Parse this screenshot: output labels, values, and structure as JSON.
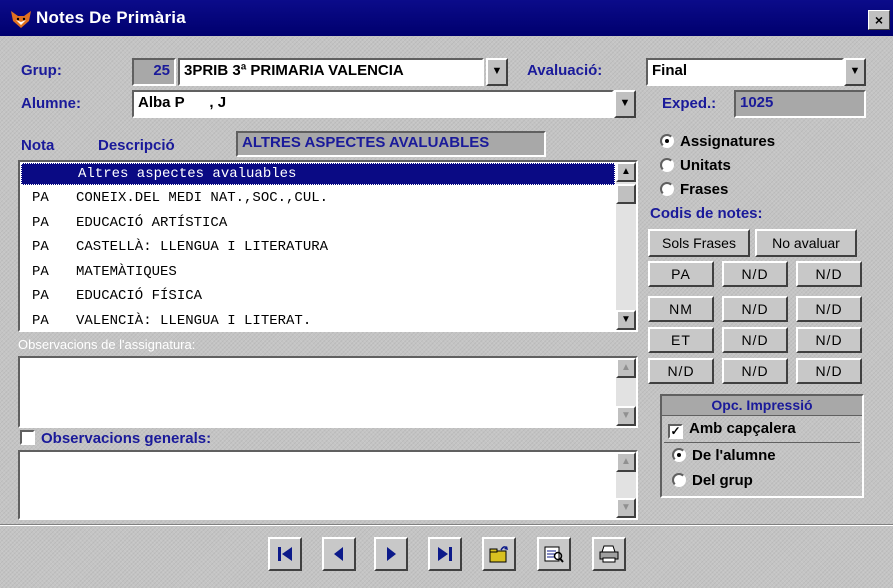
{
  "window": {
    "title": "Notes De Primària",
    "close_glyph": "×"
  },
  "grup": {
    "label": "Grup:",
    "number": "25",
    "value": "3PRIB 3ª PRIMARIA VALENCIA"
  },
  "avaluacio": {
    "label": "Avaluació:",
    "value": "Final"
  },
  "alumne": {
    "label": "Alumne:",
    "value": "Alba P      , J"
  },
  "exped": {
    "label": "Exped.:",
    "value": "1025"
  },
  "nota_header": {
    "nota_label": "Nota",
    "descripcio_label": "Descripció",
    "descripcio_value": "ALTRES ASPECTES AVALUABLES"
  },
  "subjects": [
    {
      "code": "",
      "name": "Altres aspectes avaluables"
    },
    {
      "code": "PA",
      "name": "CONEIX.DEL MEDI NAT.,SOC.,CUL."
    },
    {
      "code": "PA",
      "name": "EDUCACIÓ ARTÍSTICA"
    },
    {
      "code": "PA",
      "name": "CASTELLÀ: LLENGUA I LITERATURA"
    },
    {
      "code": "PA",
      "name": "MATEMÀTIQUES"
    },
    {
      "code": "PA",
      "name": "EDUCACIÓ FÍSICA"
    },
    {
      "code": "PA",
      "name": "VALENCIÀ: LLENGUA I LITERAT."
    }
  ],
  "view_options": {
    "assignatures": "Assignatures",
    "unitats": "Unitats",
    "frases": "Frases",
    "selected": "Assignatures"
  },
  "codis": {
    "label": "Codis de notes:",
    "sols_frases": "Sols Frases",
    "no_avaluar": "No avaluar",
    "grid": [
      [
        "PA",
        "N/D",
        "N/D"
      ],
      [
        "NM",
        "N/D",
        "N/D"
      ],
      [
        "ET",
        "N/D",
        "N/D"
      ],
      [
        "N/D",
        "N/D",
        "N/D"
      ]
    ]
  },
  "observacions_assignatura": {
    "label": "Observacions de l'assignatura:",
    "value": ""
  },
  "observacions_generals": {
    "label": "Observacions generals:",
    "checked": false,
    "value": ""
  },
  "impressio": {
    "title": "Opc. Impressió",
    "amb_capcalera": "Amb capçalera",
    "amb_capcalera_checked": true,
    "de_alumne": "De l'alumne",
    "del_grup": "Del grup",
    "selected": "De l'alumne"
  },
  "toolbar": {
    "buttons": [
      "first-record-icon",
      "previous-record-icon",
      "next-record-icon",
      "last-record-icon",
      "open-folder-icon",
      "preview-icon",
      "print-icon"
    ]
  },
  "colors": {
    "title_bar": "#00006e",
    "label_blue": "#1a1a9a",
    "selection": "#0a0a84"
  }
}
